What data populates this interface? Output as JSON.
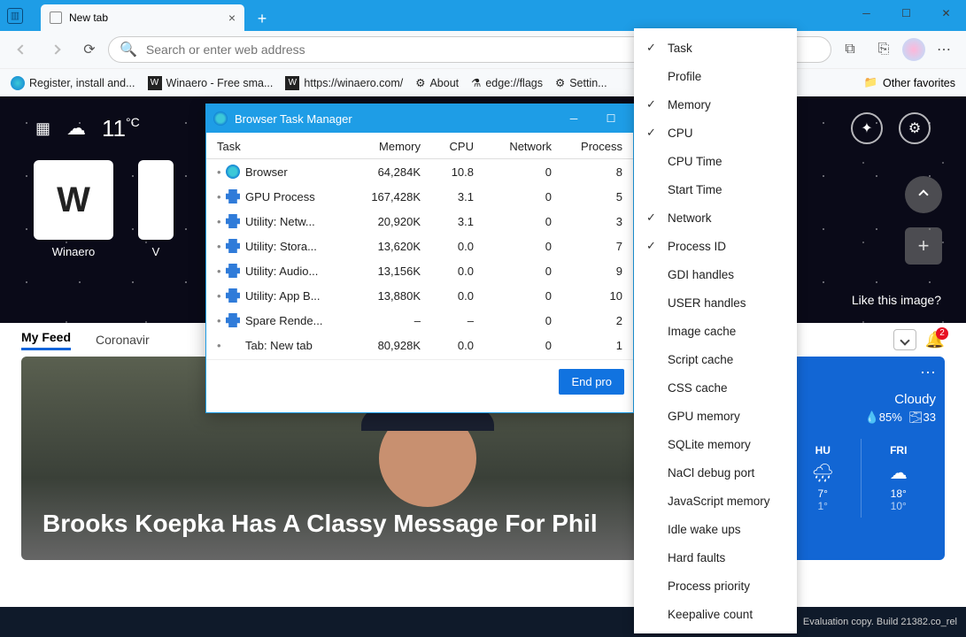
{
  "window": {
    "tab_title": "New tab"
  },
  "toolbar": {
    "placeholder": "Search or enter web address"
  },
  "bookmarks": {
    "items": [
      "Register, install and...",
      "Winaero - Free sma...",
      "https://winaero.com/",
      "About",
      "edge://flags",
      "Settin..."
    ],
    "other": "Other favorites"
  },
  "sky": {
    "temp": "11",
    "unit": "°C",
    "tile1": "Winaero",
    "tile2_prefix": "V",
    "like": "Like this image?"
  },
  "feed": {
    "tabs": [
      "My Feed",
      "Coronavir"
    ],
    "bell_count": "2"
  },
  "news": {
    "headline": "Brooks Koepka Has A Classy Message For Phil"
  },
  "weather": {
    "cond": "Cloudy",
    "hum_a": "85%",
    "hum_b": "33",
    "days": [
      {
        "name": "HU",
        "hi": "7°",
        "lo": "1°"
      },
      {
        "name": "FRI",
        "hi": "18°",
        "lo": "10°"
      }
    ]
  },
  "taskbar": {
    "text": "Evaluation copy. Build 21382.co_rel"
  },
  "task_manager": {
    "title": "Browser Task Manager",
    "columns": [
      "Task",
      "Memory",
      "CPU",
      "Network",
      "Process"
    ],
    "rows": [
      {
        "icon": "edge",
        "task": "Browser",
        "mem": "64,284K",
        "cpu": "10.8",
        "net": "0",
        "pid": "8"
      },
      {
        "icon": "puzzle",
        "task": "GPU Process",
        "mem": "167,428K",
        "cpu": "3.1",
        "net": "0",
        "pid": "5"
      },
      {
        "icon": "puzzle",
        "task": "Utility: Netw...",
        "mem": "20,920K",
        "cpu": "3.1",
        "net": "0",
        "pid": "3"
      },
      {
        "icon": "puzzle",
        "task": "Utility: Stora...",
        "mem": "13,620K",
        "cpu": "0.0",
        "net": "0",
        "pid": "7"
      },
      {
        "icon": "puzzle",
        "task": "Utility: Audio...",
        "mem": "13,156K",
        "cpu": "0.0",
        "net": "0",
        "pid": "9"
      },
      {
        "icon": "puzzle",
        "task": "Utility: App B...",
        "mem": "13,880K",
        "cpu": "0.0",
        "net": "0",
        "pid": "10"
      },
      {
        "icon": "puzzle",
        "task": "Spare Rende...",
        "mem": "–",
        "cpu": "–",
        "net": "0",
        "pid": "2"
      },
      {
        "icon": "tab",
        "task": "Tab: New tab",
        "mem": "80,928K",
        "cpu": "0.0",
        "net": "0",
        "pid": "1"
      }
    ],
    "end_btn": "End pro"
  },
  "context_menu": {
    "items": [
      {
        "label": "Task",
        "checked": true
      },
      {
        "label": "Profile",
        "checked": false
      },
      {
        "label": "Memory",
        "checked": true
      },
      {
        "label": "CPU",
        "checked": true
      },
      {
        "label": "CPU Time",
        "checked": false
      },
      {
        "label": "Start Time",
        "checked": false
      },
      {
        "label": "Network",
        "checked": true
      },
      {
        "label": "Process ID",
        "checked": true
      },
      {
        "label": "GDI handles",
        "checked": false
      },
      {
        "label": "USER handles",
        "checked": false
      },
      {
        "label": "Image cache",
        "checked": false
      },
      {
        "label": "Script cache",
        "checked": false
      },
      {
        "label": "CSS cache",
        "checked": false
      },
      {
        "label": "GPU memory",
        "checked": false
      },
      {
        "label": "SQLite memory",
        "checked": false
      },
      {
        "label": "NaCl debug port",
        "checked": false
      },
      {
        "label": "JavaScript memory",
        "checked": false
      },
      {
        "label": "Idle wake ups",
        "checked": false
      },
      {
        "label": "Hard faults",
        "checked": false
      },
      {
        "label": "Process priority",
        "checked": false
      },
      {
        "label": "Keepalive count",
        "checked": false
      }
    ]
  }
}
